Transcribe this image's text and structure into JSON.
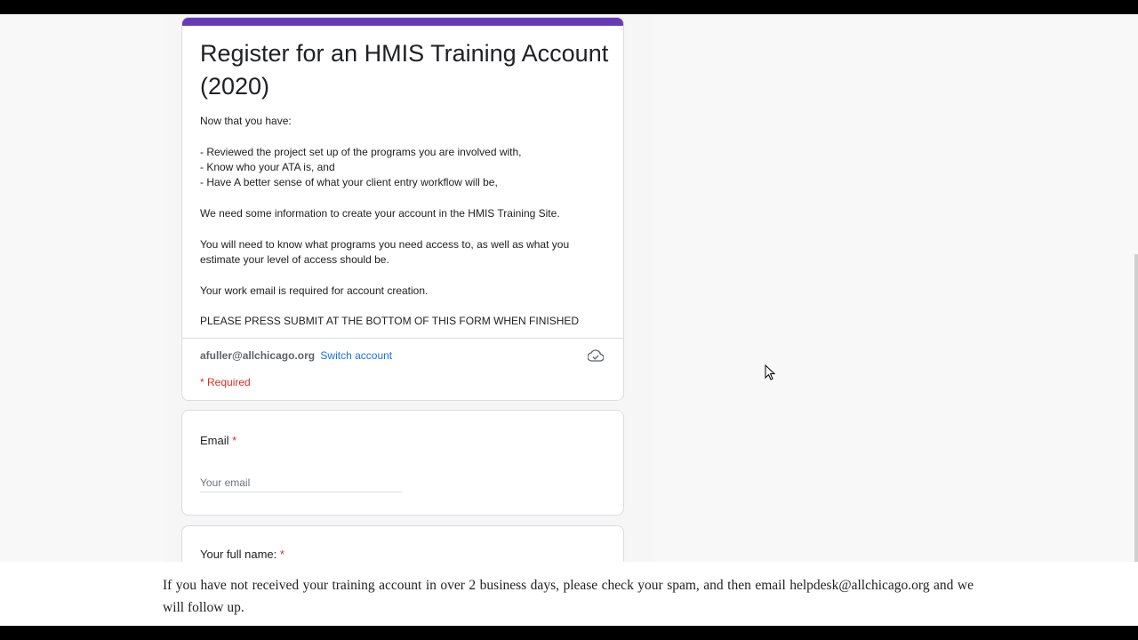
{
  "form": {
    "title": "Register for an HMIS Training Account (2020)",
    "description": {
      "intro": "Now that you have:",
      "bullets": [
        "- Reviewed the project set up of the programs you are involved with,",
        "- Know who your ATA is, and",
        "- Have A better sense of what your client entry workflow will be,"
      ],
      "p1": "We need some information to create your account in the HMIS Training Site.",
      "p2": "You will need to know what programs you need access to, as well as what you estimate your level of access should be.",
      "p3": "Your work email is required for account creation.",
      "p4": "PLEASE PRESS SUBMIT AT THE BOTTOM OF THIS FORM WHEN FINISHED"
    },
    "account": {
      "email": "afuller@allchicago.org",
      "switch_label": "Switch account",
      "icon": "cloud-check-icon"
    },
    "required_note": "* Required",
    "questions": [
      {
        "label": "Email",
        "required_mark": "*",
        "placeholder": "Your email"
      },
      {
        "label": "Your full name:",
        "required_mark": "*"
      }
    ],
    "accent_color": "#673ab7",
    "link_color": "#1a73e8",
    "required_color": "#d93025"
  },
  "footer": {
    "text": "If you have not received your training account in over 2 business days, please check your spam, and then email helpdesk@allchicago.org and we will follow up."
  }
}
